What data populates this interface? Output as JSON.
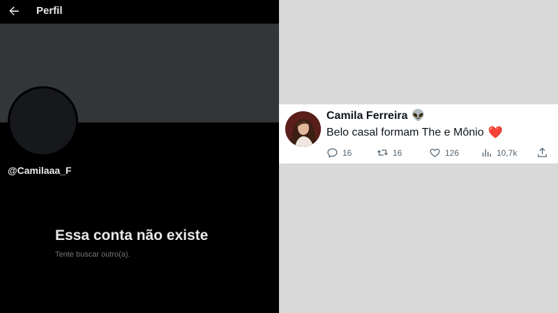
{
  "profile": {
    "header_title": "Perfil",
    "handle": "@Camilaaa_F",
    "empty_title": "Essa conta não existe",
    "empty_subtitle": "Tente buscar outro(a)."
  },
  "tweet": {
    "author_name": "Camila Ferreira",
    "author_emoji": "👽",
    "text": "Belo casal formam The e Mônio",
    "text_emoji": "❤️",
    "actions": {
      "replies": "16",
      "retweets": "16",
      "likes": "126",
      "views": "10,7k"
    },
    "icons": [
      "reply-icon",
      "retweet-icon",
      "like-icon",
      "views-icon",
      "share-icon"
    ]
  },
  "colors": {
    "dark_bg": "#000000",
    "banner": "#333639",
    "text_light": "#e7e9ea",
    "text_muted": "#71767b",
    "action_gray": "#536471",
    "heart_red": "#d8263f"
  }
}
